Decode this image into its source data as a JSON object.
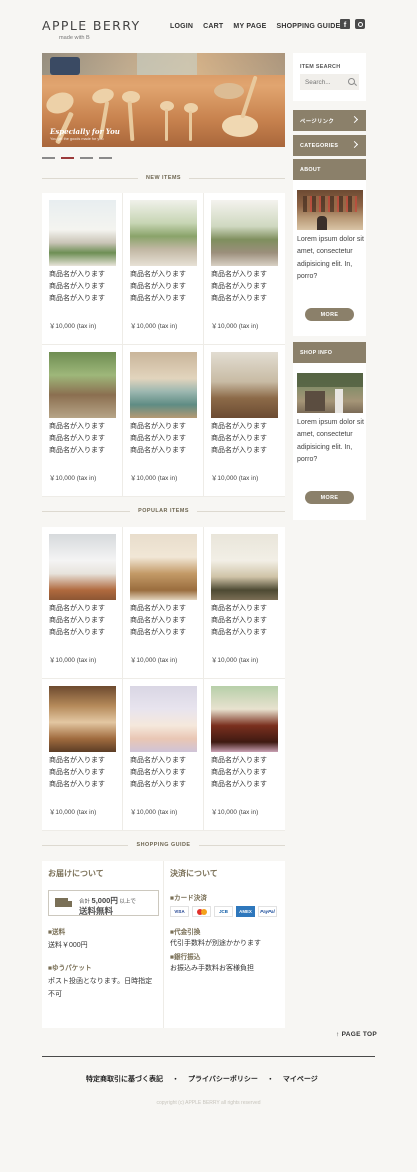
{
  "brand": {
    "name": "APPLE BERRY",
    "tagline": "made with B"
  },
  "nav": [
    "LOGIN",
    "CART",
    "MY PAGE",
    "SHOPPING GUIDE"
  ],
  "social": {
    "facebook": "f"
  },
  "hero": {
    "title": "Especially for You",
    "subtitle": "You gift the goods made for you"
  },
  "sections": {
    "new": "NEW ITEMS",
    "popular": "POPULAR ITEMS",
    "guide": "SHOPPING GUIDE"
  },
  "product": {
    "name_lines": [
      "商品名が入ります",
      "商品名が入ります",
      "商品名が入ります"
    ],
    "price": "￥10,000 (tax in)"
  },
  "sidebar": {
    "search_title": "ITEM SEARCH",
    "search_placeholder": "Search...",
    "buttons": [
      "ページリンク",
      "CATEGORIES",
      "ABOUT"
    ],
    "about_text": "Lorem ipsum dolor sit amet, consectetur adipisicing elit. In, porro?",
    "more": "MORE",
    "shop_info": "SHOP INFO",
    "shop_text": "Lorem ipsum dolor sit amet, consectetur adipisicing elit. In, porro?"
  },
  "guide": {
    "delivery_title": "お届けについて",
    "free_small": "合計",
    "free_amount": "5,000円",
    "free_suffix": "以上で",
    "free_big": "送料無料",
    "shipping_title": "■送料",
    "shipping_text": "送料￥000円",
    "yupacket_title": "■ゆうパケット",
    "yupacket_text": "ポスト投函となります。日時指定不可",
    "payment_title": "決済について",
    "card_title": "■カード決済",
    "cards": [
      "VISA",
      "MC",
      "JCB",
      "AMEX",
      "PayPal"
    ],
    "cod_title": "■代金引換",
    "cod_text": "代引手数料が別途かかります",
    "bank_title": "■銀行振込",
    "bank_text": "お振込み手数料お客様負担"
  },
  "page_top": "↑ PAGE TOP",
  "footer": {
    "links": [
      "特定商取引に基づく表記",
      "プライバシーポリシー",
      "マイページ"
    ],
    "separator": "・",
    "copyright": "copyright (c) APPLE BERRY all rights reserved"
  },
  "colors": {
    "accent": "#8b806a",
    "background": "#f7f6f3",
    "active_dot": "#9b3a3a"
  }
}
